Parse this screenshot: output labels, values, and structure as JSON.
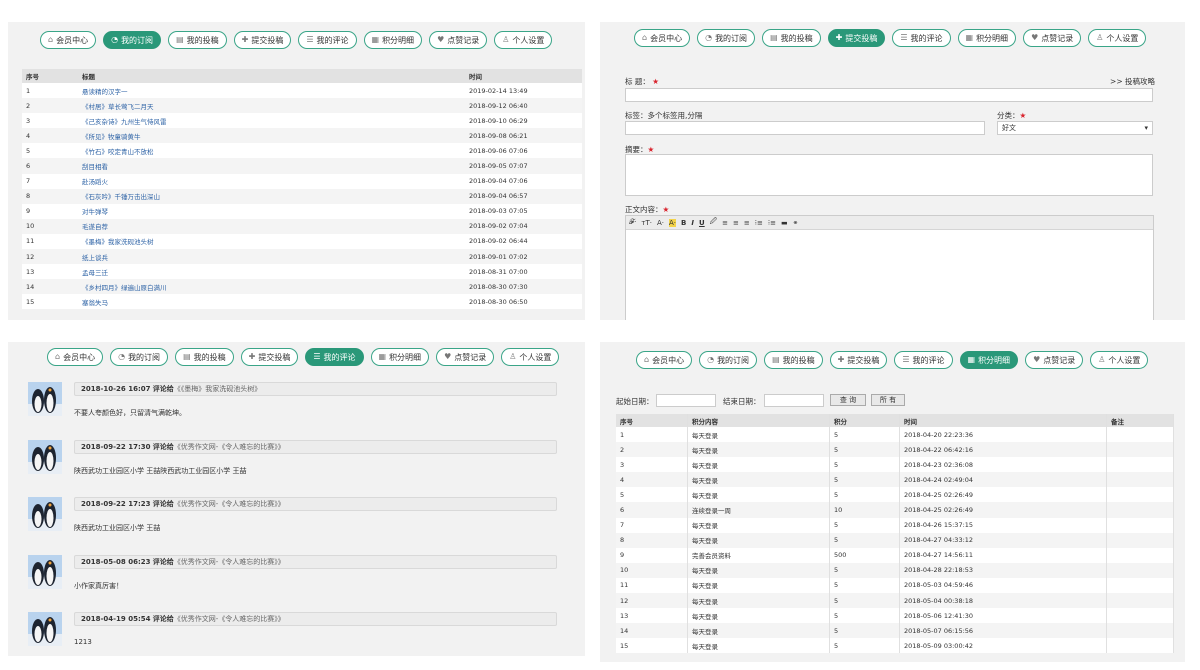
{
  "nav": [
    "会员中心",
    "我的订阅",
    "我的投稿",
    "提交投稿",
    "我的评论",
    "积分明细",
    "点赞记录",
    "个人设置"
  ],
  "subscriptions": {
    "headers": [
      "序号",
      "标题",
      "时间"
    ],
    "rows": [
      [
        "1",
        "悬读精的汉字一",
        "2019-02-14 13:49"
      ],
      [
        "2",
        "《村居》草长莺飞二月天",
        "2018-09-12 06:40"
      ],
      [
        "3",
        "《己亥杂诗》九州生气恃风雷",
        "2018-09-10 06:29"
      ],
      [
        "4",
        "《所见》牧童骑黄牛",
        "2018-09-08 06:21"
      ],
      [
        "5",
        "《竹石》咬定青山不放松",
        "2018-09-06 07:06"
      ],
      [
        "6",
        "刮目相看",
        "2018-09-05 07:07"
      ],
      [
        "7",
        "赴汤蹈火",
        "2018-09-04 07:06"
      ],
      [
        "8",
        "《石灰吟》千锤万击出深山",
        "2018-09-04 06:57"
      ],
      [
        "9",
        "对牛弹琴",
        "2018-09-03 07:05"
      ],
      [
        "10",
        "毛遂自荐",
        "2018-09-02 07:04"
      ],
      [
        "11",
        "《墨梅》我家洗砚池头树",
        "2018-09-02 06:44"
      ],
      [
        "12",
        "纸上谈兵",
        "2018-09-01 07:02"
      ],
      [
        "13",
        "孟母三迁",
        "2018-08-31 07:00"
      ],
      [
        "14",
        "《乡村四月》绿遍山原白满川",
        "2018-08-30 07:30"
      ],
      [
        "15",
        "塞翁失马",
        "2018-08-30 06:50"
      ]
    ]
  },
  "submit": {
    "title_label": "标 题：",
    "guide_link": ">> 投稿攻略",
    "tags_label": "标签：多个标签用,分隔",
    "category_label": "分类：",
    "category_value": "好文",
    "summary_label": "摘要：",
    "body_label": "正文内容：",
    "required_mark": "★",
    "toolbar": [
      "𝓕·",
      "тT·",
      "A·",
      "A·",
      "B",
      "I",
      "U",
      "🖉",
      "≡",
      "≡",
      "≡",
      "⁝≡",
      "⁝≡",
      "▬",
      "⚭"
    ]
  },
  "comments": [
    {
      "date": "2018-10-26 16:07",
      "verb": "评论给",
      "target": "《《墨梅》我家洗砚池头树》",
      "text": "不要人夸颜色好，只留清气满乾坤。"
    },
    {
      "date": "2018-09-22 17:30",
      "verb": "评论给",
      "target": "《优秀作文网-《令人难忘的比赛》》",
      "text": "陕西武功工业园区小学 王喆陕西武功工业园区小学 王喆"
    },
    {
      "date": "2018-09-22 17:23",
      "verb": "评论给",
      "target": "《优秀作文网-《令人难忘的比赛》》",
      "text": "陕西武功工业园区小学 王喆"
    },
    {
      "date": "2018-05-08 06:23",
      "verb": "评论给",
      "target": "《优秀作文网-《令人难忘的比赛》》",
      "text": "小作家真厉害！"
    },
    {
      "date": "2018-04-19 05:54",
      "verb": "评论给",
      "target": "《优秀作文网-《令人难忘的比赛》》",
      "text": "1213"
    }
  ],
  "points": {
    "start_label": "起始日期：",
    "end_label": "结束日期：",
    "query_btn": "查 询",
    "all_btn": "所 有",
    "headers": [
      "序号",
      "积分内容",
      "积分",
      "时间",
      "备注"
    ],
    "rows": [
      [
        "1",
        "每天登录",
        "5",
        "2018-04-20 22:23:36",
        ""
      ],
      [
        "2",
        "每天登录",
        "5",
        "2018-04-22 06:42:16",
        ""
      ],
      [
        "3",
        "每天登录",
        "5",
        "2018-04-23 02:36:08",
        ""
      ],
      [
        "4",
        "每天登录",
        "5",
        "2018-04-24 02:49:04",
        ""
      ],
      [
        "5",
        "每天登录",
        "5",
        "2018-04-25 02:26:49",
        ""
      ],
      [
        "6",
        "连续登录一周",
        "10",
        "2018-04-25 02:26:49",
        ""
      ],
      [
        "7",
        "每天登录",
        "5",
        "2018-04-26 15:37:15",
        ""
      ],
      [
        "8",
        "每天登录",
        "5",
        "2018-04-27 04:33:12",
        ""
      ],
      [
        "9",
        "完善会员资料",
        "500",
        "2018-04-27 14:56:11",
        ""
      ],
      [
        "10",
        "每天登录",
        "5",
        "2018-04-28 22:18:53",
        ""
      ],
      [
        "11",
        "每天登录",
        "5",
        "2018-05-03 04:59:46",
        ""
      ],
      [
        "12",
        "每天登录",
        "5",
        "2018-05-04 00:38:18",
        ""
      ],
      [
        "13",
        "每天登录",
        "5",
        "2018-05-06 12:41:30",
        ""
      ],
      [
        "14",
        "每天登录",
        "5",
        "2018-05-07 06:15:56",
        ""
      ],
      [
        "15",
        "每天登录",
        "5",
        "2018-05-09 03:00:42",
        ""
      ]
    ]
  },
  "colors": {
    "accent": "#2a9879",
    "link": "#2e63a6",
    "required": "#d9232d"
  }
}
